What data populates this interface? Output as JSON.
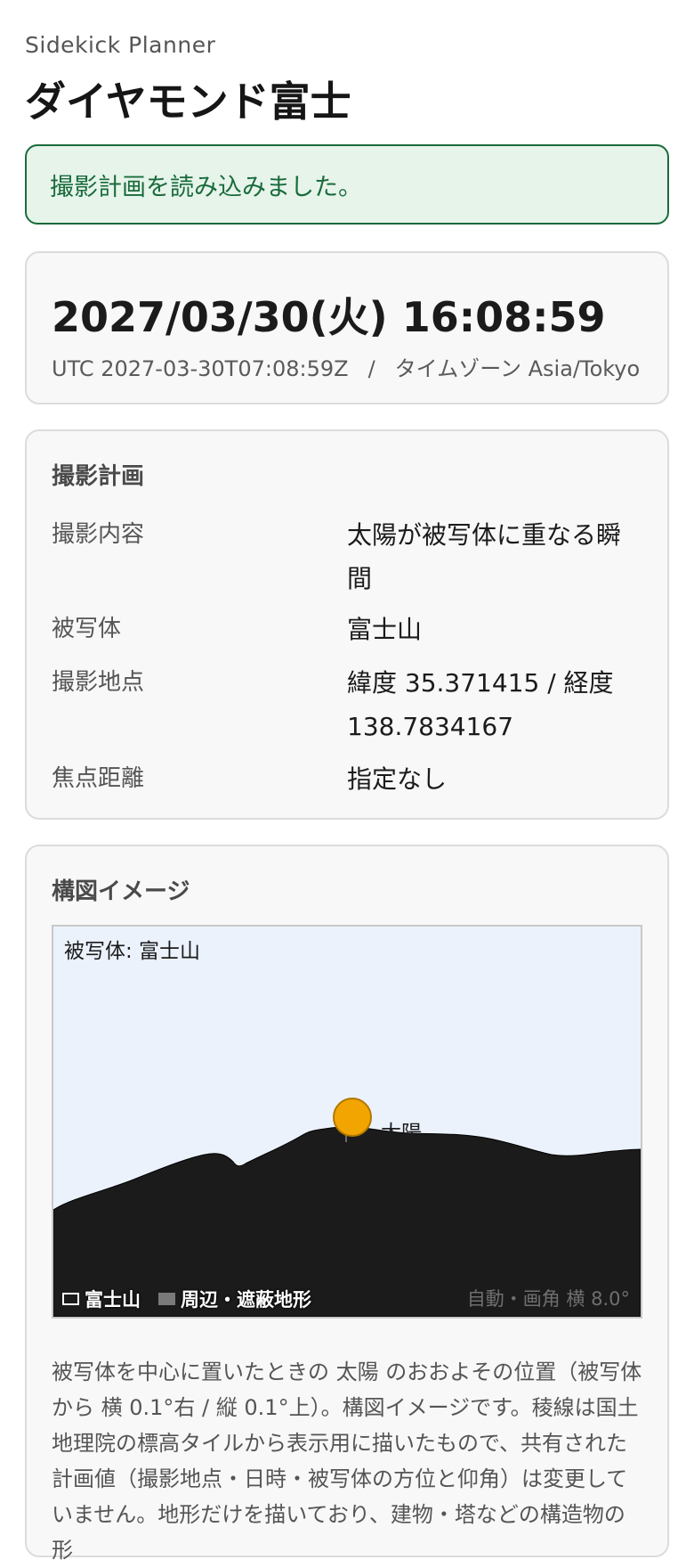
{
  "app_name": "Sidekick Planner",
  "page_title": "ダイヤモンド富士",
  "notice": "撮影計画を読み込みました。",
  "time": {
    "local": "2027/03/30(火) 16:08:59",
    "utc": "UTC 2027-03-30T07:08:59Z",
    "separator": "/",
    "timezone": "タイムゾーン Asia/Tokyo"
  },
  "plan": {
    "title": "撮影計画",
    "rows": [
      {
        "label": "撮影内容",
        "value": "太陽が被写体に重なる瞬間"
      },
      {
        "label": "被写体",
        "value": "富士山"
      },
      {
        "label": "撮影地点",
        "value": "緯度 35.371415 / 経度 138.7834167"
      },
      {
        "label": "焦点距離",
        "value": "指定なし"
      }
    ]
  },
  "composition": {
    "title": "構図イメージ",
    "subject_label": "被写体: 富士山",
    "sun_label": "太陽",
    "legend_subject": "富士山",
    "legend_terrain": "周辺・遮蔽地形",
    "fov_label": "自動・画角 横 8.0°",
    "caption": "被写体を中心に置いたときの 太陽 のおおよその位置（被写体から 横 0.1°右 / 縦 0.1°上）。構図イメージです。稜線は国土地理院の標高タイルから表示用に描いたもので、共有された計画値（撮影地点・日時・被写体の方位と仰角）は変更していません。地形だけを描いており、建物・塔などの構造物の形",
    "colors": {
      "sky": "#ebf2fc",
      "terrain": "#1b1b1b",
      "sun": "#f2a500",
      "sun_outline": "#b07800"
    }
  }
}
